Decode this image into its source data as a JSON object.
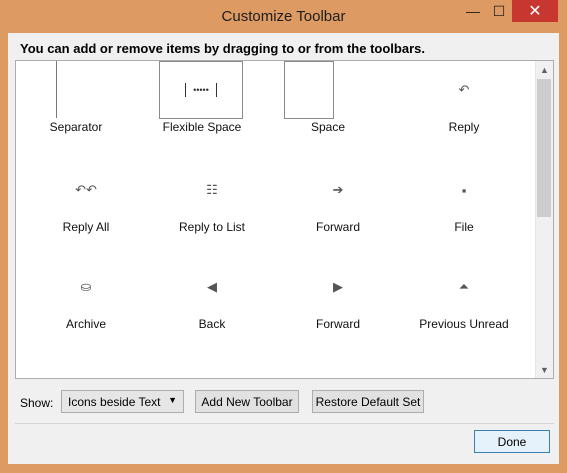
{
  "window": {
    "title": "Customize Toolbar",
    "controls": {
      "minimize": "—",
      "maximize": "☐",
      "close": "✕"
    }
  },
  "headline": "You can add or remove items by dragging to or from the toolbars.",
  "palette": {
    "items": [
      {
        "label": "Separator",
        "icon": "separator-line"
      },
      {
        "label": "Flexible Space",
        "icon": "flexible-space"
      },
      {
        "label": "Space",
        "icon": "space-box"
      },
      {
        "label": "Reply",
        "icon": "reply-arrow-icon",
        "glyph": "↶"
      },
      {
        "label": "Reply All",
        "icon": "reply-all-icon",
        "glyph": "↶↶"
      },
      {
        "label": "Reply to List",
        "icon": "reply-to-list-icon",
        "glyph": "☷"
      },
      {
        "label": "Forward",
        "icon": "forward-arrow-icon",
        "glyph": "➔"
      },
      {
        "label": "File",
        "icon": "file-icon",
        "glyph": "▪"
      },
      {
        "label": "Archive",
        "icon": "archive-icon",
        "glyph": "⛀"
      },
      {
        "label": "Back",
        "icon": "back-icon",
        "glyph": "◀"
      },
      {
        "label": "Forward",
        "icon": "forward-icon",
        "glyph": "▶"
      },
      {
        "label": "Previous Unread",
        "icon": "previous-unread-icon",
        "glyph": "⏶"
      }
    ],
    "flexible_space_glyph": "•••••"
  },
  "footer": {
    "show_label": "Show:",
    "show_value": "Icons beside Text",
    "add_toolbar": "Add New Toolbar",
    "restore_default": "Restore Default Set",
    "done": "Done"
  },
  "colors": {
    "frame": "#dd9a63",
    "close_button": "#c7372f",
    "dialog_bg": "#f0f0f0"
  }
}
